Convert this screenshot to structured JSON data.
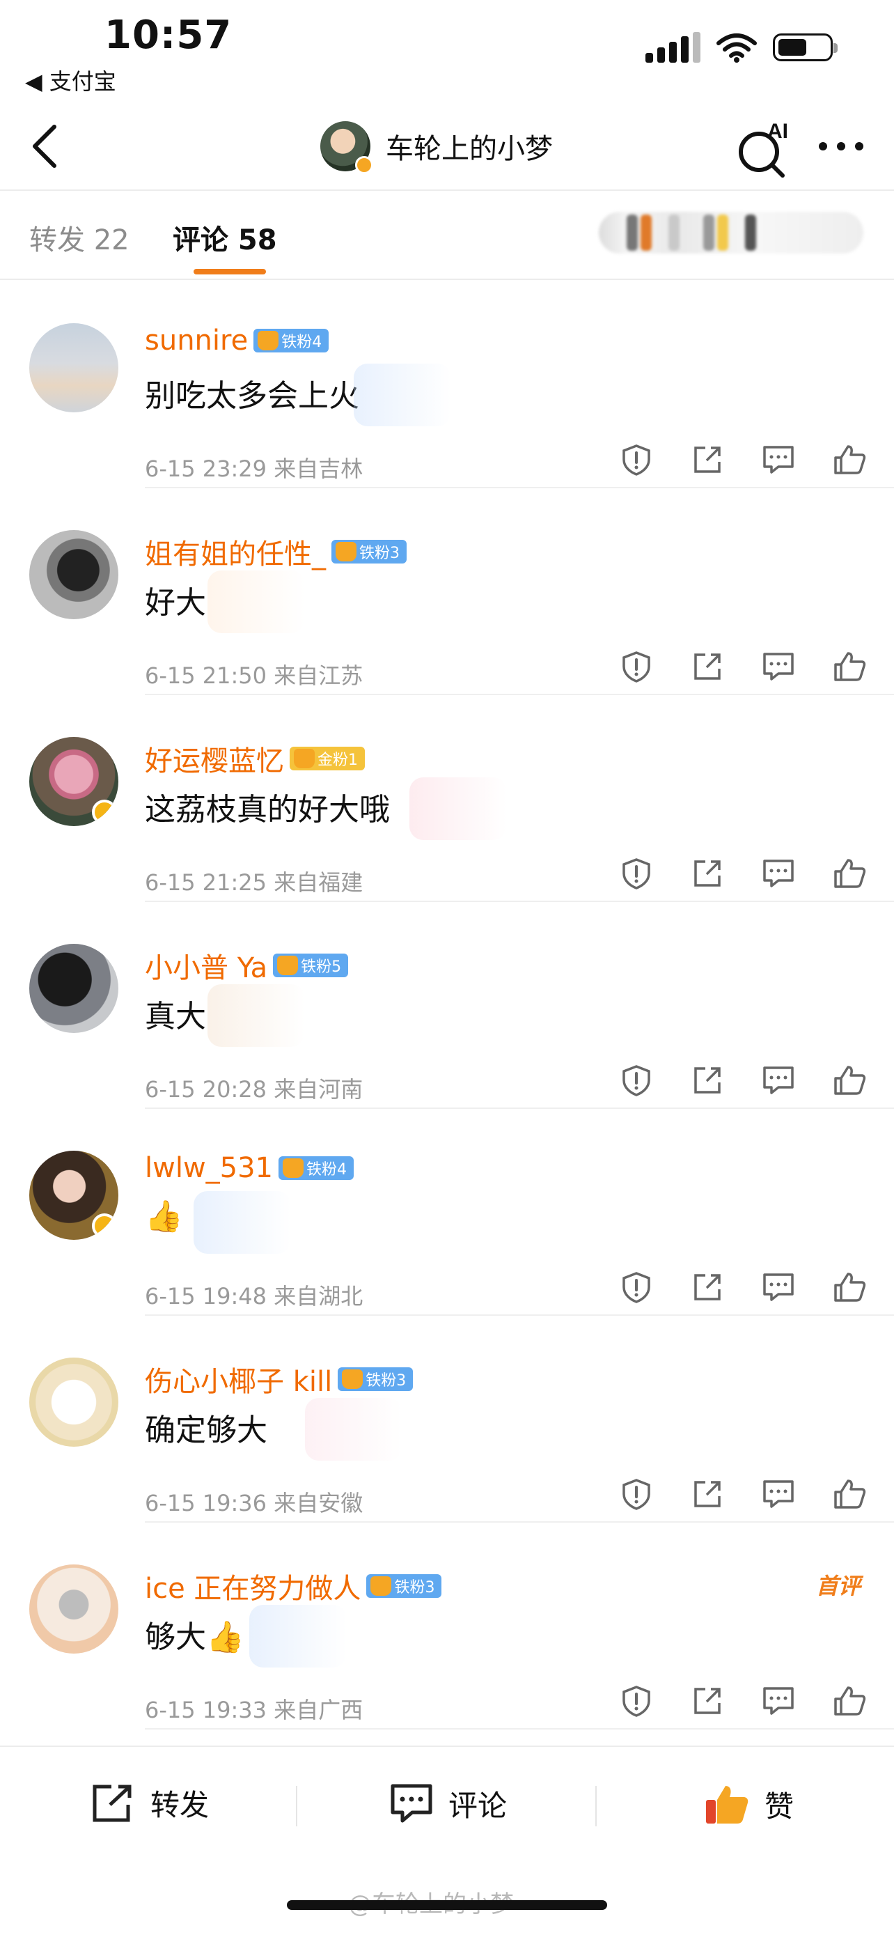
{
  "status_bar": {
    "time": "10:57",
    "back_app": "◀ 支付宝"
  },
  "nav": {
    "title": "车轮上的小梦",
    "ai_label": "AI"
  },
  "tabs": {
    "repost": "转发 22",
    "comment": "评论 58"
  },
  "comments": [
    {
      "user": "sunnire",
      "fan_badge": "铁粉4",
      "text": "别吃太多会上火",
      "meta": "6-15 23:29  来自吉林",
      "first": ""
    },
    {
      "user": "姐有姐的任性_",
      "fan_badge": "铁粉3",
      "text": "好大",
      "meta": "6-15 21:50  来自江苏",
      "first": ""
    },
    {
      "user": "好运樱蓝忆",
      "fan_badge": "金粉1",
      "text": "这荔枝真的好大哦",
      "meta": "6-15 21:25  来自福建",
      "first": ""
    },
    {
      "user": "小小普 Ya",
      "fan_badge": "铁粉5",
      "text": "真大",
      "meta": "6-15 20:28  来自河南",
      "first": ""
    },
    {
      "user": "lwlw_531",
      "fan_badge": "铁粉4",
      "text": "👍",
      "meta": "6-15 19:48  来自湖北",
      "first": ""
    },
    {
      "user": "伤心小椰子 kill",
      "fan_badge": "铁粉3",
      "text": "确定够大",
      "meta": "6-15 19:36  来自安徽",
      "first": ""
    },
    {
      "user": "ice 正在努力做人",
      "fan_badge": "铁粉3",
      "text": "够大👍",
      "meta": "6-15 19:33  来自广西",
      "first": "首评"
    }
  ],
  "bottom_bar": {
    "repost": "转发",
    "comment": "评论",
    "like": "赞"
  },
  "watermark": "@车轮上的小梦",
  "colors": {
    "accent": "#f07d1a",
    "username": "#f06a00",
    "fan_badge": "#5fa8f0",
    "gold_badge": "#f5c33b"
  }
}
